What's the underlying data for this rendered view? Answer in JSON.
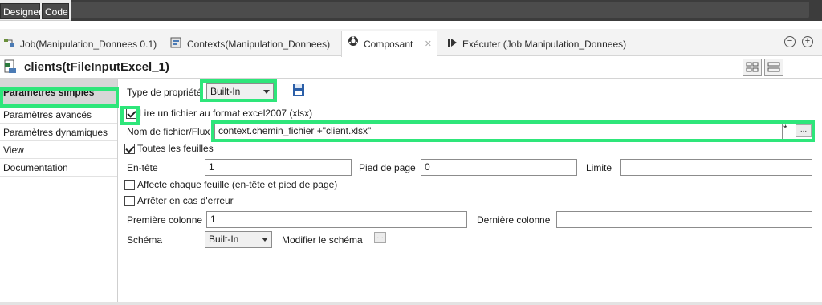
{
  "top_tabs": {
    "designer": "Designer",
    "code": "Code"
  },
  "view_tabs": [
    {
      "label": "Job(Manipulation_Donnees 0.1)",
      "icon": "job-icon"
    },
    {
      "label": "Contexts(Manipulation_Donnees)",
      "icon": "contexts-icon"
    },
    {
      "label": "Composant",
      "icon": "component-gear-icon"
    },
    {
      "label": "Exécuter (Job Manipulation_Donnees)",
      "icon": "run-icon"
    }
  ],
  "component": {
    "title": "clients(tFileInputExcel_1)",
    "icon": "excel-file-icon"
  },
  "sidebar": {
    "items": [
      {
        "label": "Paramètres simples",
        "active": true
      },
      {
        "label": "Paramètres avancés"
      },
      {
        "label": "Paramètres dynamiques"
      },
      {
        "label": "View"
      },
      {
        "label": "Documentation"
      }
    ]
  },
  "form": {
    "property_type_label": "Type de propriété",
    "property_type_value": "Built-In",
    "excel2007_label": "Lire un fichier au format excel2007 (xlsx)",
    "excel2007_checked": true,
    "filename_label": "Nom de fichier/Flux",
    "filename_value": "context.chemin_fichier +\"client.xlsx\"",
    "filename_marker": "*",
    "browse_label": "...",
    "all_sheets_label": "Toutes les feuilles",
    "all_sheets_checked": true,
    "header_label": "En-tête",
    "header_value": "1",
    "footer_label": "Pied de page",
    "footer_value": "0",
    "limit_label": "Limite",
    "limit_value": "",
    "affect_sheet_label": "Affecte chaque feuille (en-tête et pied de page)",
    "stop_on_error_label": "Arrêter en cas d'erreur",
    "first_column_label": "Première colonne",
    "first_column_value": "1",
    "last_column_label": "Dernière colonne",
    "last_column_value": "",
    "schema_label": "Schéma",
    "schema_value": "Built-In",
    "edit_schema_label": "Modifier le schéma",
    "edit_schema_button": "..."
  },
  "colors": {
    "highlight": "#2ee67a",
    "active_nav": "#d7d7d7",
    "topbar_dark": "#3c3c3c"
  }
}
